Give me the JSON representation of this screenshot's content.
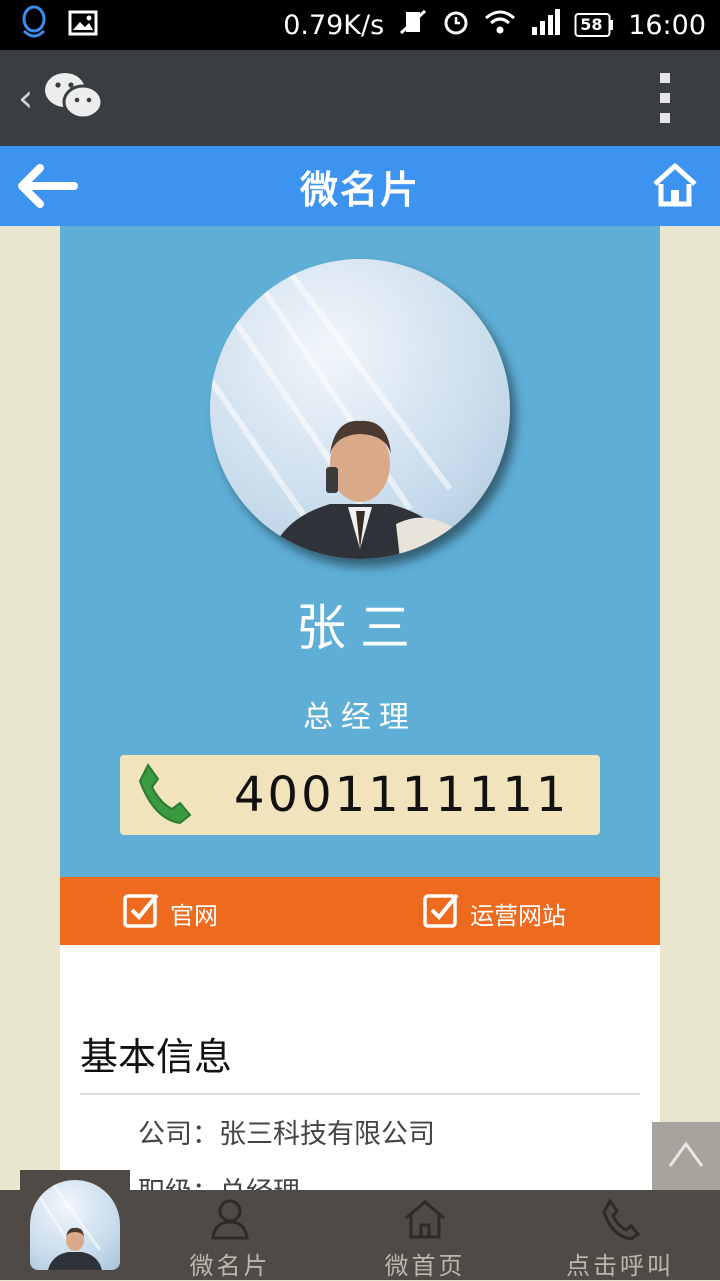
{
  "status": {
    "speed": "0.79K/s",
    "battery": "58",
    "time": "16:00"
  },
  "header": {
    "title": "微名片"
  },
  "profile": {
    "name": "张三",
    "position": "总经理",
    "phone": "4001111111"
  },
  "links": [
    {
      "label": "官网"
    },
    {
      "label": "运营网站"
    }
  ],
  "info": {
    "title": "基本信息",
    "rows": [
      {
        "text": "公司：张三科技有限公司"
      },
      {
        "text": "职级：总经理"
      }
    ]
  },
  "nav": [
    {
      "label": "微名片"
    },
    {
      "label": "微首页"
    },
    {
      "label": "点击呼叫"
    }
  ],
  "colors": {
    "title_bar": "#3c93f0",
    "profile_bg": "#5eaed6",
    "link_bar": "#ed6a1e",
    "phone_box": "#f1e3bc",
    "nav_bg": "#4f4a45"
  }
}
